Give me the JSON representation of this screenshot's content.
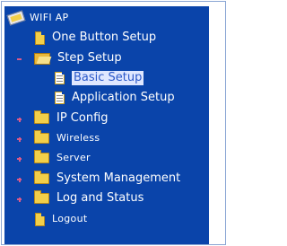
{
  "tree": {
    "root": {
      "label": "WIFI AP",
      "icon": "network-root-icon"
    },
    "items": [
      {
        "label": "One Button Setup",
        "icon": "page-icon"
      },
      {
        "label": "Step Setup",
        "icon": "folder-open-icon",
        "expanded": true,
        "children": [
          {
            "label": "Basic Setup",
            "icon": "document-icon",
            "selected": true
          },
          {
            "label": "Application Setup",
            "icon": "document-icon"
          }
        ]
      },
      {
        "label": "IP Config",
        "icon": "folder-icon",
        "expanded": false
      },
      {
        "label": "Wireless",
        "icon": "folder-icon",
        "expanded": false
      },
      {
        "label": "Server",
        "icon": "folder-icon",
        "expanded": false
      },
      {
        "label": "System Management",
        "icon": "folder-icon",
        "expanded": false
      },
      {
        "label": "Log and Status",
        "icon": "folder-icon",
        "expanded": false
      },
      {
        "label": "Logout",
        "icon": "page-icon"
      }
    ]
  },
  "colors": {
    "panel_bg": "#0a44aa",
    "text": "#ffffff",
    "selected_bg": "#dfe7ff",
    "selected_text": "#2a58c9",
    "expander": "#d85a8a",
    "folder": "#f2cf4a"
  }
}
